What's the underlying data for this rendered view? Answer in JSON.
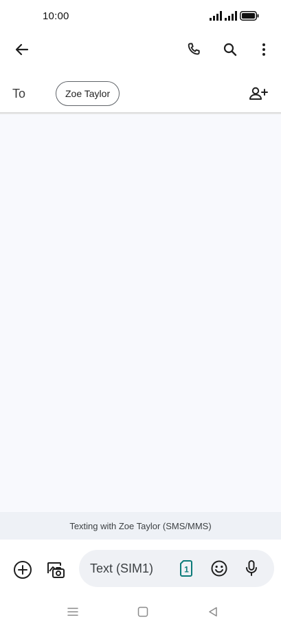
{
  "status_bar": {
    "time": "10:00",
    "icons": [
      "signal-icon",
      "signal-icon",
      "battery-icon"
    ]
  },
  "app_bar": {
    "icons": [
      "back-arrow-icon",
      "phone-icon",
      "search-icon",
      "more-vert-icon"
    ]
  },
  "recipient": {
    "to_label": "To",
    "chip_name": "Zoe Taylor",
    "add_icon": "person-add-icon"
  },
  "conversation": {
    "info_text": "Texting with Zoe Taylor (SMS/MMS)"
  },
  "compose": {
    "placeholder": "Text (SIM1)",
    "sim_number": "1",
    "icons": [
      "add-circle-icon",
      "gallery-icon",
      "sim-card-icon",
      "emoji-icon",
      "mic-icon"
    ]
  },
  "nav_bar": {
    "icons": [
      "menu-icon",
      "home-icon",
      "back-triangle-icon"
    ]
  },
  "colors": {
    "accent": "#0b7a78",
    "conversation_bg": "#f8f9fd",
    "info_bar_bg": "#eef1f6",
    "input_bg": "#eff1f5"
  }
}
